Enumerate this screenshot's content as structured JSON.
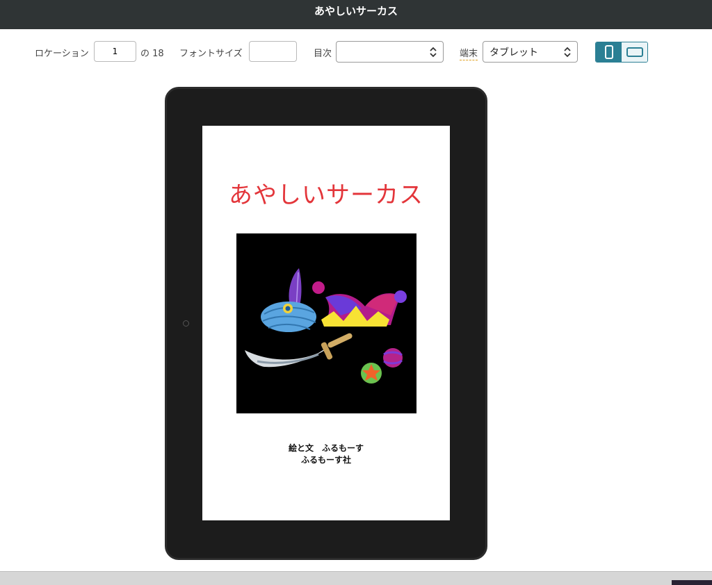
{
  "window": {
    "title": "あやしいサーカス"
  },
  "toolbar": {
    "location_label": "ロケーション",
    "location_value": "1",
    "location_total": "の 18",
    "fontsize_label": "フォントサイズ",
    "fontsize_value": "",
    "toc_label": "目次",
    "toc_value": "",
    "device_label": "端末",
    "device_value": "タブレット",
    "orientation_selected": "portrait"
  },
  "book": {
    "title": "あやしいサーカス",
    "author_line": "絵と文　ふるもーす",
    "publisher_line": "ふるもーす社"
  },
  "colors": {
    "titlebar": "#2f3435",
    "accent": "#2b7f94",
    "title_red": "#e3353a",
    "tablet_frame": "#1c1c1c"
  },
  "icons": [
    "chevron-updown-icon",
    "portrait-icon",
    "landscape-icon",
    "home-button"
  ]
}
